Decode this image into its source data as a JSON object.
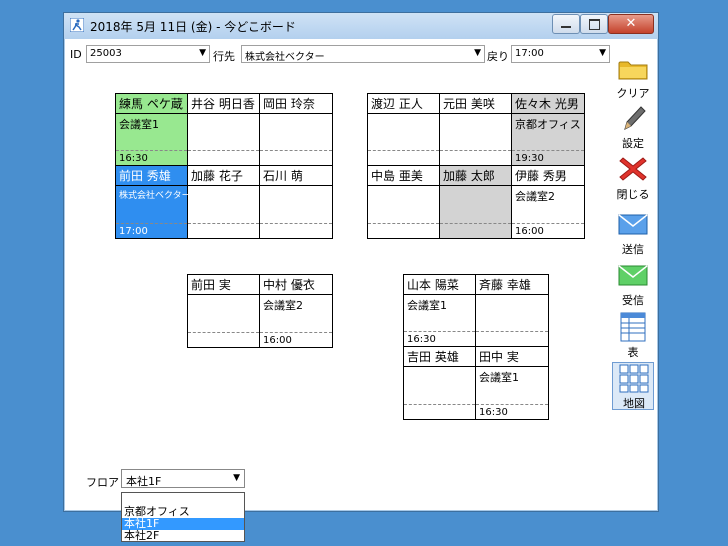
{
  "window": {
    "title": "2018年 5月 11日 (金) - 今どこボード"
  },
  "toolbar": {
    "id_label": "ID",
    "id_value": "25003",
    "dest_label": "行先",
    "dest_value": "株式会社ベクター",
    "return_label": "戻り",
    "return_value": "17:00"
  },
  "sidebar": {
    "clear": "クリア",
    "settings": "設定",
    "close": "閉じる",
    "send": "送信",
    "receive": "受信",
    "table": "表",
    "map": "地図"
  },
  "groups": [
    {
      "cells": [
        {
          "name": "練馬 ペケ蔵",
          "location": "会議室1",
          "time": "16:30",
          "status": "green"
        },
        {
          "name": "井谷 明日香",
          "location": "",
          "time": "",
          "status": "none"
        },
        {
          "name": "岡田 玲奈",
          "location": "",
          "time": "",
          "status": "none"
        },
        {
          "name": "前田 秀雄",
          "location": "株式会社ベクター",
          "time": "17:00",
          "status": "blue"
        },
        {
          "name": "加藤 花子",
          "location": "",
          "time": "",
          "status": "none"
        },
        {
          "name": "石川 萌",
          "location": "",
          "time": "",
          "status": "none"
        }
      ]
    },
    {
      "cells": [
        {
          "name": "渡辺 正人",
          "location": "",
          "time": "",
          "status": "none"
        },
        {
          "name": "元田 美咲",
          "location": "",
          "time": "",
          "status": "none"
        },
        {
          "name": "佐々木 光男",
          "location": "京都オフィス",
          "time": "19:30",
          "status": "gray"
        },
        {
          "name": "中島 亜美",
          "location": "",
          "time": "",
          "status": "none"
        },
        {
          "name": "加藤 太郎",
          "location": "",
          "time": "",
          "status": "gray"
        },
        {
          "name": "伊藤 秀男",
          "location": "会議室2",
          "time": "16:00",
          "status": "none"
        }
      ]
    },
    {
      "cells": [
        {
          "name": "前田 実",
          "location": "",
          "time": "",
          "status": "none"
        },
        {
          "name": "中村 優衣",
          "location": "会議室2",
          "time": "16:00",
          "status": "none"
        }
      ]
    },
    {
      "cells": [
        {
          "name": "山本 陽菜",
          "location": "会議室1",
          "time": "16:30",
          "status": "none"
        },
        {
          "name": "斉藤 幸雄",
          "location": "",
          "time": "",
          "status": "none"
        },
        {
          "name": "吉田 英雄",
          "location": "",
          "time": "",
          "status": "none"
        },
        {
          "name": "田中 実",
          "location": "会議室1",
          "time": "16:30",
          "status": "none"
        }
      ]
    }
  ],
  "floor": {
    "label": "フロア",
    "selected": "本社1F",
    "options": [
      "京都オフィス",
      "本社1F",
      "本社2F"
    ]
  },
  "colors": {
    "green": "#98e890",
    "blue": "#2f8ef0",
    "gray": "#d3d3d3",
    "desktop": "#4a8fcf"
  }
}
